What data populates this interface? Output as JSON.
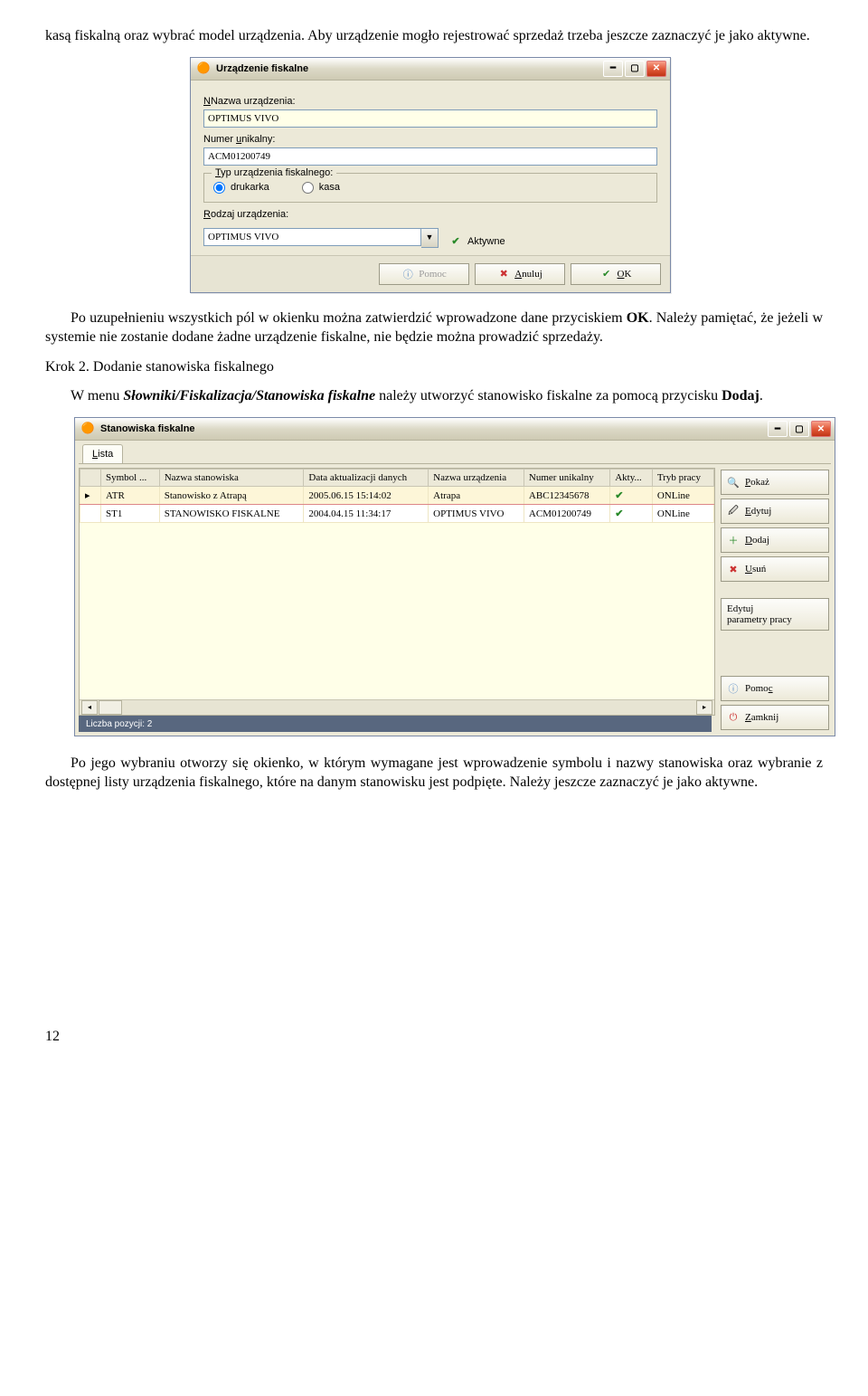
{
  "para1": "kasą fiskalną oraz wybrać model urządzenia. Aby urządzenie mogło rejestrować sprzedaż trzeba jeszcze zaznaczyć je jako aktywne.",
  "win1": {
    "title": "Urządzenie fiskalne",
    "lbl_name": "Nazwa urządzenia:",
    "val_name": "OPTIMUS VIVO",
    "lbl_num": "Numer unikalny:",
    "val_num": "ACM01200749",
    "fs_legend": "Typ urządzenia fiskalnego:",
    "radio_drukarka": "drukarka",
    "radio_kasa": "kasa",
    "lbl_rodzaj": "Rodzaj urządzenia:",
    "val_rodzaj": "OPTIMUS VIVO",
    "chk_aktywne": "Aktywne",
    "btn_pomoc": "Pomoc",
    "btn_anuluj": "Anuluj",
    "btn_ok": "OK"
  },
  "para2_a": "Po uzupełnieniu wszystkich pól w okienku można zatwierdzić wprowadzone dane przyciskiem ",
  "para2_b": ". Należy pamiętać, że jeżeli w systemie nie zostanie dodane żadne urządzenie fiskalne, nie będzie można prowadzić sprzedaży.",
  "bold_ok": "OK",
  "step2_head": "Krok 2. Dodanie stanowiska fiskalnego",
  "step2_text_a": "W menu ",
  "step2_bold": "Słowniki/Fiskalizacja/Stanowiska fiskalne",
  "step2_text_b": " należy utworzyć stanowisko fiskalne za pomocą przycisku ",
  "step2_bold2": "Dodaj",
  "win2": {
    "title": "Stanowiska fiskalne",
    "tab_lista": "Lista",
    "cols": {
      "c1": "Symbol ...",
      "c2": "Nazwa stanowiska",
      "c3": "Data aktualizacji danych",
      "c4": "Nazwa urządzenia",
      "c5": "Numer unikalny",
      "c6": "Akty...",
      "c7": "Tryb pracy"
    },
    "rows": [
      {
        "c1": "ATR",
        "c2": "Stanowisko z Atrapą",
        "c3": "2005.06.15 15:14:02",
        "c4": "Atrapa",
        "c5": "ABC12345678",
        "c7": "ONLine"
      },
      {
        "c1": "ST1",
        "c2": "STANOWISKO FISKALNE",
        "c3": "2004.04.15 11:34:17",
        "c4": "OPTIMUS VIVO",
        "c5": "ACM01200749",
        "c7": "ONLine"
      }
    ],
    "count": "Liczba pozycji: 2",
    "side": {
      "pokaz": "Pokaż",
      "edytuj": "Edytuj",
      "dodaj": "Dodaj",
      "usun": "Usuń",
      "edparam": "Edytuj\nparametry pracy",
      "pomoc": "Pomoc",
      "zamknij": "Zamknij"
    }
  },
  "para3": "Po jego wybraniu otworzy się okienko, w którym wymagane jest wprowadzenie symbolu i nazwy stanowiska oraz wybranie z dostępnej listy urządzenia fiskalnego, które na danym stanowisku jest podpięte. Należy jeszcze zaznaczyć je jako aktywne.",
  "pagenum": "12"
}
